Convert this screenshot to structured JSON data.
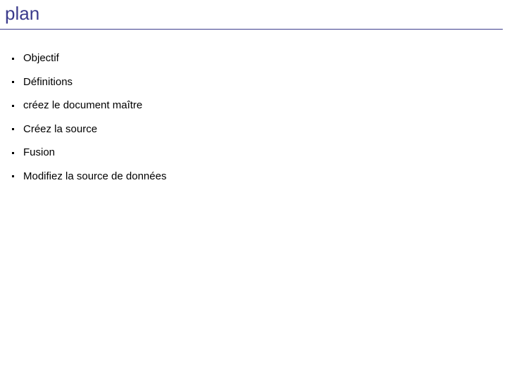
{
  "slide": {
    "title": "plan",
    "title_color": "#3b3b8c",
    "rule_color": "#3b3b8c",
    "background_color": "#ffffff",
    "text_color": "#000000",
    "bullets": [
      {
        "label": "Objectif"
      },
      {
        "label": "Définitions"
      },
      {
        "label": "créez le document maître"
      },
      {
        "label": "Créez la source"
      },
      {
        "label": "Fusion"
      },
      {
        "label": "Modifiez la source de données"
      }
    ]
  }
}
